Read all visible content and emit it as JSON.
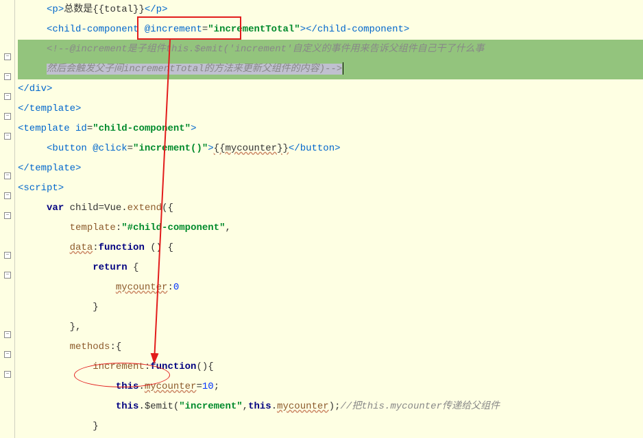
{
  "lines": {
    "l1": "<p>总数是{{total}}</p>",
    "l2_a": "<child-component",
    "l2_attr": " @increment",
    "l2_eq": "=",
    "l2_val": "\"incrementTotal\"",
    "l2_b": "></child-component>",
    "l3": "<!--@increment是子组件this.$emit('increment'自定义的事件用来告诉父组件自己干了什么事",
    "l4": "然后会触发父子间incrementTotal的方法来更新父组件的内容)-->",
    "l5": "</div>",
    "l6": "</template>",
    "l7_a": "<template",
    "l7_attr": " id",
    "l7_eq": "=",
    "l7_val": "\"child-component\"",
    "l7_b": ">",
    "l8_a": "<button",
    "l8_attr": " @click",
    "l8_eq": "=",
    "l8_val": "\"increment()\"",
    "l8_b": ">",
    "l8_txt": "{{mycounter}}",
    "l8_c": "</button>",
    "l9": "</template>",
    "l10": "<script>",
    "l11_a": "var",
    "l11_b": " child=Vue.",
    "l11_c": "extend",
    "l11_d": "({",
    "l12_a": "template",
    "l12_b": ":",
    "l12_c": "\"#child-component\"",
    "l12_d": ",",
    "l13_a": "data",
    "l13_b": ":",
    "l13_c": "function",
    "l13_d": " () {",
    "l14_a": "return",
    "l14_b": " {",
    "l15_a": "mycounter",
    "l15_b": ":",
    "l15_c": "0",
    "l16": "}",
    "l17": "},",
    "l18_a": "methods",
    "l18_b": ":{",
    "l19_a": "increment",
    "l19_b": ":",
    "l19_c": "function",
    "l19_d": "(){",
    "l20_a": "this",
    "l20_b": ".",
    "l20_c": "mycounter",
    "l20_d": "=",
    "l20_e": "10",
    "l20_f": ";",
    "l21_a": "this",
    "l21_b": ".$emit(",
    "l21_c": "\"increment\"",
    "l21_d": ",",
    "l21_e": "this",
    "l21_f": ".",
    "l21_g": "mycounter",
    "l21_h": ");",
    "l21_cmt": "//把this.mycounter传递给父组件",
    "l22": "}"
  }
}
